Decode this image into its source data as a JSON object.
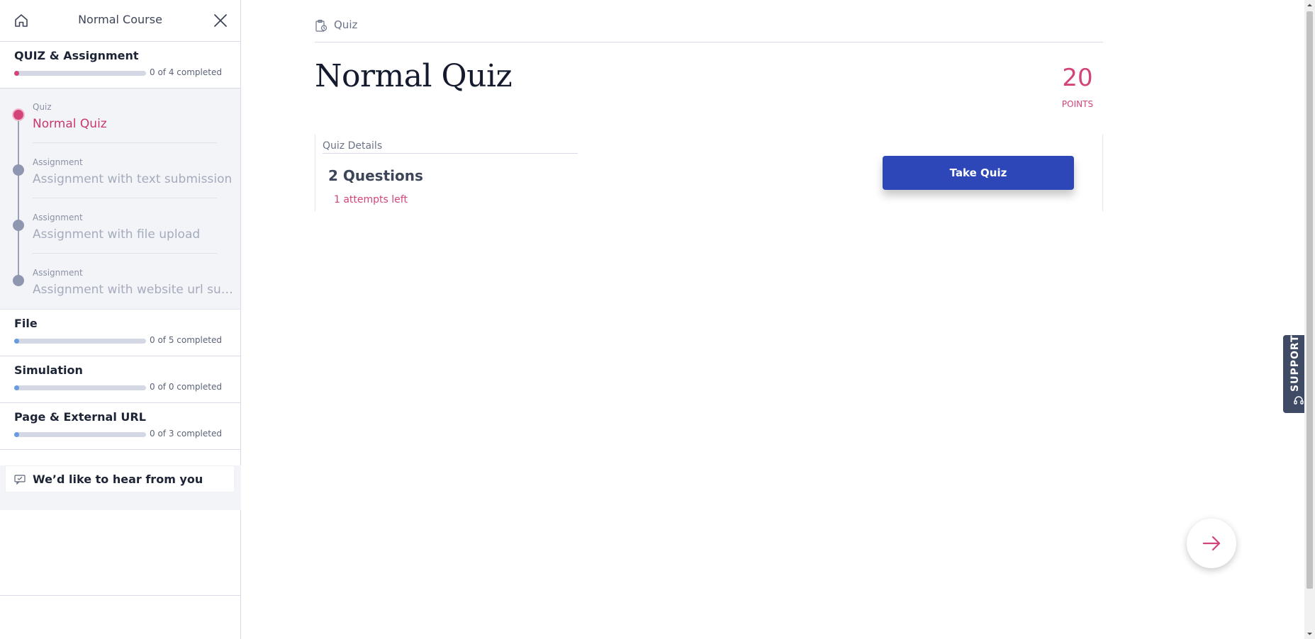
{
  "sidebar": {
    "course_title": "Normal Course",
    "sections": [
      {
        "title": "QUIZ & Assignment",
        "progress_text": "0 of 4 completed",
        "dot_color": "#d2447a",
        "completed": 0,
        "total": 4
      },
      {
        "title": "File",
        "progress_text": "0 of 5 completed",
        "dot_color": "#6a9be0",
        "completed": 0,
        "total": 5
      },
      {
        "title": "Simulation",
        "progress_text": "0 of 0 completed",
        "dot_color": "#6a9be0",
        "completed": 0,
        "total": 0
      },
      {
        "title": "Page & External URL",
        "progress_text": "0 of 3 completed",
        "dot_color": "#6a9be0",
        "completed": 0,
        "total": 3
      }
    ],
    "items": [
      {
        "kind": "Quiz",
        "name": "Normal Quiz",
        "active": true
      },
      {
        "kind": "Assignment",
        "name": "Assignment with text submission",
        "active": false
      },
      {
        "kind": "Assignment",
        "name": "Assignment with file upload",
        "active": false
      },
      {
        "kind": "Assignment",
        "name": "Assignment with website url submission",
        "active": false
      }
    ],
    "feedback_label": "We’d like to hear from you"
  },
  "main": {
    "breadcrumb": "Quiz",
    "title": "Normal Quiz",
    "points_value": "20",
    "points_label": "POINTS",
    "details_label": "Quiz Details",
    "questions": "2 Questions",
    "attempts": "1 attempts left",
    "take_quiz_label": "Take Quiz"
  },
  "support_label": "SUPPORT",
  "colors": {
    "accent": "#d2447a",
    "primary_button": "#2d47b8",
    "support_tab": "#3f4a65"
  },
  "icons": [
    "home-icon",
    "close-icon",
    "quiz-icon",
    "feedback-icon",
    "headset-icon",
    "arrow-right-icon"
  ]
}
